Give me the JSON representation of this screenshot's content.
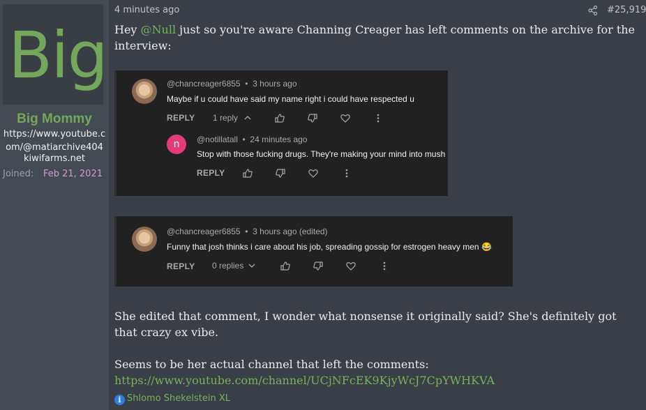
{
  "user": {
    "avatar_text": "Big",
    "name": "Big Mommy",
    "title": "https://www.youtube.com/@matiarchive404",
    "site": "kiwifarms.net",
    "joined_label": "Joined:",
    "joined_value": "Feb 21, 2021"
  },
  "post": {
    "date": "4 minutes ago",
    "number": "#25,919",
    "intro_pre": "Hey ",
    "mention": "@Null",
    "intro_post": " just so you're aware Channing Creager has left comments on the archive for the interview:",
    "para2": "She edited that comment, I wonder what nonsense it originally said? She's definitely got that crazy ex vibe.",
    "para3": "Seems to be her actual channel that left the comments:",
    "link": "https://www.youtube.com/channel/UCjNFcEK9KjyWcJ7CpYWHKVA",
    "signature": "Shlomo Shekelstein XL"
  },
  "screenshot1": {
    "comment": {
      "handle": "@chancreager6855",
      "time": "3 hours ago",
      "text": "Maybe if u could have said my name right i could have respected u",
      "reply_label": "REPLY",
      "replies": "1 reply"
    },
    "reply": {
      "avatar_letter": "n",
      "handle": "@notillatall",
      "time": "24 minutes ago",
      "text": "Stop with those fucking drugs. They're making your mind into mush",
      "reply_label": "REPLY"
    }
  },
  "screenshot2": {
    "comment": {
      "handle": "@chancreager6855",
      "time": "3 hours ago (edited)",
      "text": "Funny that josh thinks i care about his job, spreading gossip for estrogen heavy men",
      "emoji": "😂",
      "reply_label": "REPLY",
      "replies": "0 replies"
    }
  },
  "colors": {
    "accent": "#74b55c",
    "sidebar_bg": "#444a52",
    "post_bg": "#3a3e46",
    "joined_value": "#d79ad1",
    "screenshot_bg": "#212121"
  }
}
